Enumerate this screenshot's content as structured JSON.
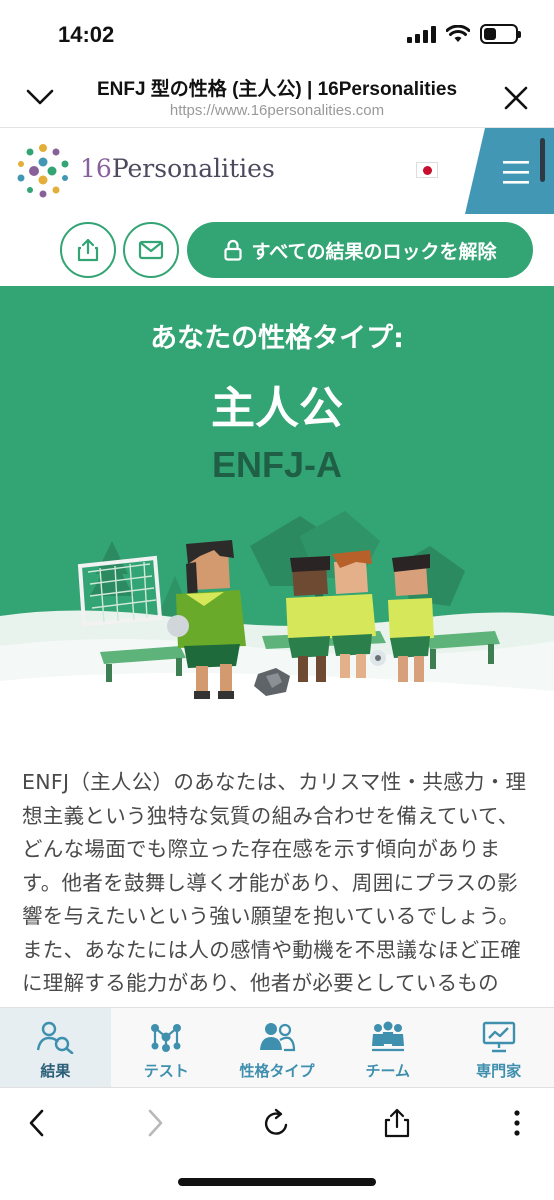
{
  "status_bar": {
    "time": "14:02"
  },
  "browser": {
    "page_title": "ENFJ 型の性格 (主人公) | 16Personalities",
    "url": "https://www.16personalities.com"
  },
  "site": {
    "logo_number": "16",
    "logo_word": "Personalities",
    "language_flag": "jp-flag-icon",
    "menu_icon": "hamburger-icon"
  },
  "actions": {
    "share_icon": "share-icon",
    "email_icon": "email-icon",
    "unlock_label": "すべての結果のロックを解除"
  },
  "hero": {
    "subtitle": "あなたの性格タイプ:",
    "type_name": "主人公",
    "type_code": "ENFJ-A"
  },
  "content": {
    "paragraph": "ENFJ（主人公）のあなたは、カリスマ性・共感力・理想主義という独特な気質の組み合わせを備えていて、どんな場面でも際立った存在感を示す傾向があります。他者を鼓舞し導く才能があり、周囲にプラスの影響を与えたいという強い願望を抱いているでしょう。また、あなたには人の感情や動機を不思議なほど正確に理解する能力があり、他者が必要としているものを、本人が気づく"
  },
  "bottom_nav": {
    "items": [
      {
        "label": "結果",
        "icon": "results-icon",
        "active": true
      },
      {
        "label": "テスト",
        "icon": "test-icon",
        "active": false
      },
      {
        "label": "性格タイプ",
        "icon": "personality-types-icon",
        "active": false
      },
      {
        "label": "チーム",
        "icon": "teams-icon",
        "active": false
      },
      {
        "label": "専門家",
        "icon": "professional-icon",
        "active": false
      }
    ]
  },
  "colors": {
    "brand_green": "#33a474",
    "nav_blue": "#3f8fae",
    "menu_blue": "#4298b4",
    "logo_purple": "#88619a"
  }
}
